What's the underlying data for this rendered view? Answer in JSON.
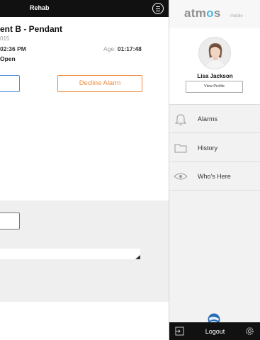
{
  "header": {
    "title": "Rehab"
  },
  "alarm": {
    "title": "ent B - Pendant",
    "date": "015",
    "time": "02:36 PM",
    "age_label": "Age:",
    "age_value": "01:17:48",
    "status": "Open",
    "decline_label": "Decline Alarm"
  },
  "sidebar": {
    "logo_main_a": "atm",
    "logo_main_o": "o",
    "logo_main_b": "s",
    "logo_sub": "mobile",
    "profile": {
      "name": "Lisa Jackson",
      "view_profile_label": "View Profile"
    },
    "nav": [
      {
        "label": "Alarms",
        "icon": "bell-icon"
      },
      {
        "label": "History",
        "icon": "folder-icon"
      },
      {
        "label": "Who's Here",
        "icon": "eye-icon"
      }
    ],
    "logout_label": "Logout"
  },
  "colors": {
    "topbar": "#111111",
    "accent_orange": "#f08a3e",
    "accent_blue": "#4a90d9",
    "logo_blue": "#4db7e8"
  }
}
